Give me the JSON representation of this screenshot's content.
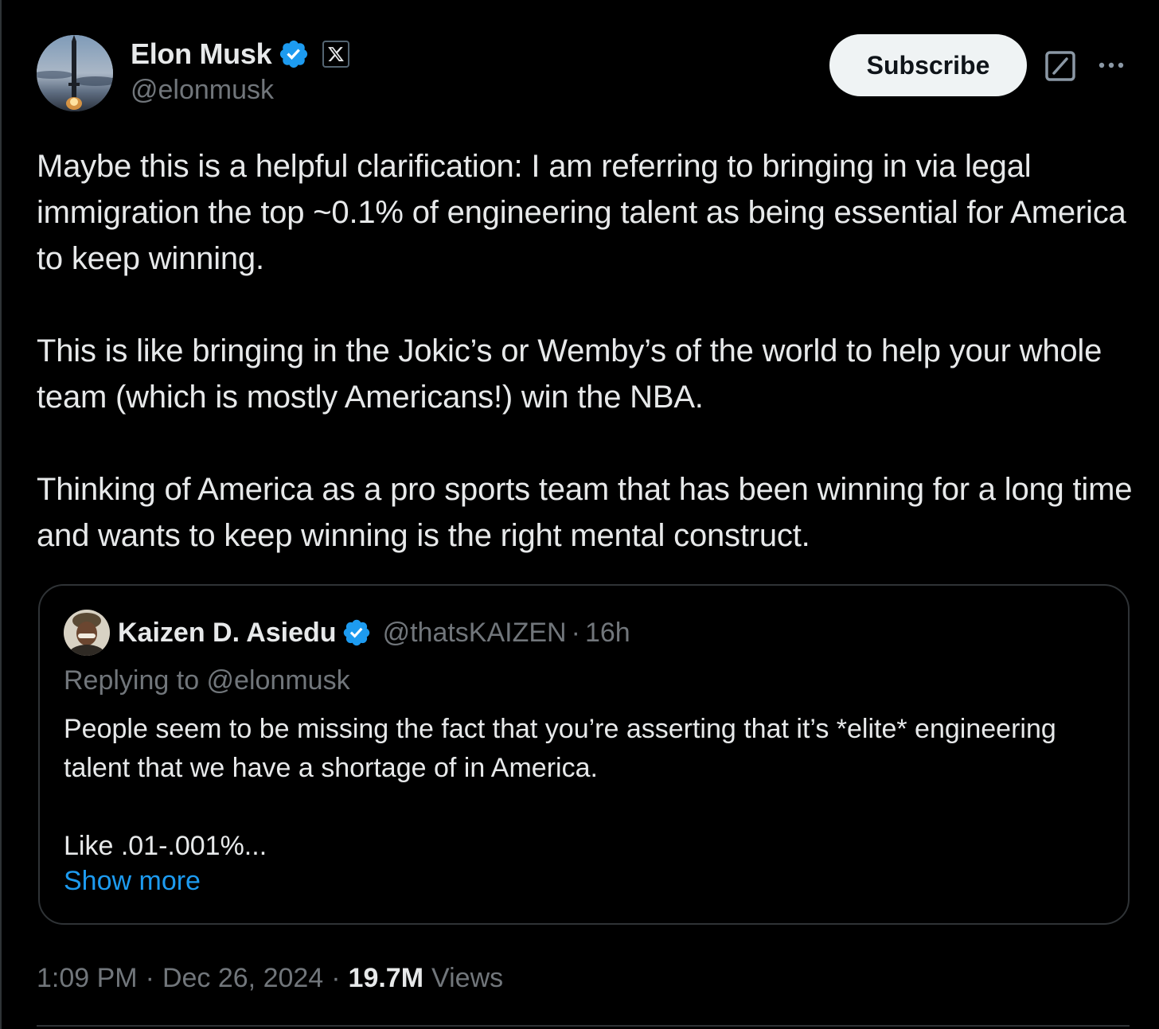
{
  "author": {
    "display_name": "Elon Musk",
    "handle": "@elonmusk",
    "verified": true,
    "affiliation_badge": "x-logo-icon"
  },
  "actions": {
    "subscribe_label": "Subscribe",
    "grok_icon": "grok-icon",
    "more_icon": "more-icon"
  },
  "tweet": {
    "paragraphs": [
      "Maybe this is a helpful clarification: I am referring to bringing in via legal immigration the top ~0.1% of engineering talent as being essential for America to keep winning.",
      "This is like bringing in the Jokic’s or Wemby’s of the world to help your whole team (which is mostly Americans!) win the NBA.",
      "Thinking of America as a pro sports team that has been winning for a long time and wants to keep winning is the right mental construct."
    ]
  },
  "quote": {
    "display_name": "Kaizen D. Asiedu",
    "handle": "@thatsKAIZEN",
    "separator": "·",
    "time": "16h",
    "verified": true,
    "replying_prefix": "Replying to ",
    "replying_to": "@elonmusk",
    "paragraphs": [
      "People seem to be missing the fact that you’re asserting that it’s *elite* engineering talent that we have a shortage of in America.",
      "Like .01-.001%..."
    ],
    "show_more_label": "Show more"
  },
  "meta": {
    "time": "1:09 PM",
    "separator": "·",
    "date": "Dec 26, 2024",
    "views_count": "19.7M",
    "views_label": "Views"
  },
  "colors": {
    "background": "#000000",
    "text_primary": "#e7e9ea",
    "text_secondary": "#71767b",
    "accent_blue": "#1d9bf0",
    "border": "#2f3336",
    "button_bg": "#eff3f4"
  }
}
